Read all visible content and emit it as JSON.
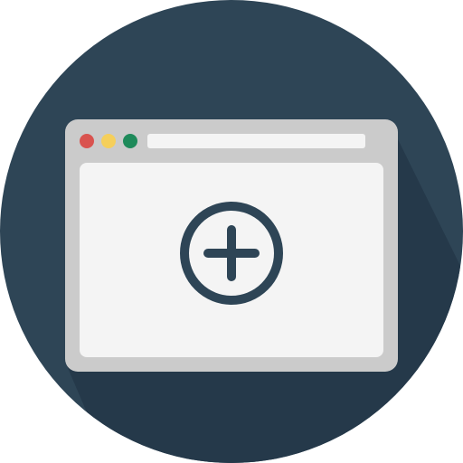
{
  "icon": {
    "name": "new-window-icon",
    "description_icons": [
      "browser-window-icon",
      "plus-circle-icon"
    ]
  },
  "colors": {
    "circle_background": "#2E4556",
    "long_shadow": "#25394A",
    "window_frame": "#CBCBCB",
    "window_content": "#F4F4F4",
    "address_bar": "#F4F4F4",
    "dot_close": "#D9534F",
    "dot_minimize": "#F5CF5B",
    "dot_maximize": "#1E8A5A",
    "plus_stroke": "#2E4556"
  },
  "window_controls": [
    {
      "name": "close-dot-icon",
      "color_key": "dot_close"
    },
    {
      "name": "minimize-dot-icon",
      "color_key": "dot_minimize"
    },
    {
      "name": "maximize-dot-icon",
      "color_key": "dot_maximize"
    }
  ]
}
